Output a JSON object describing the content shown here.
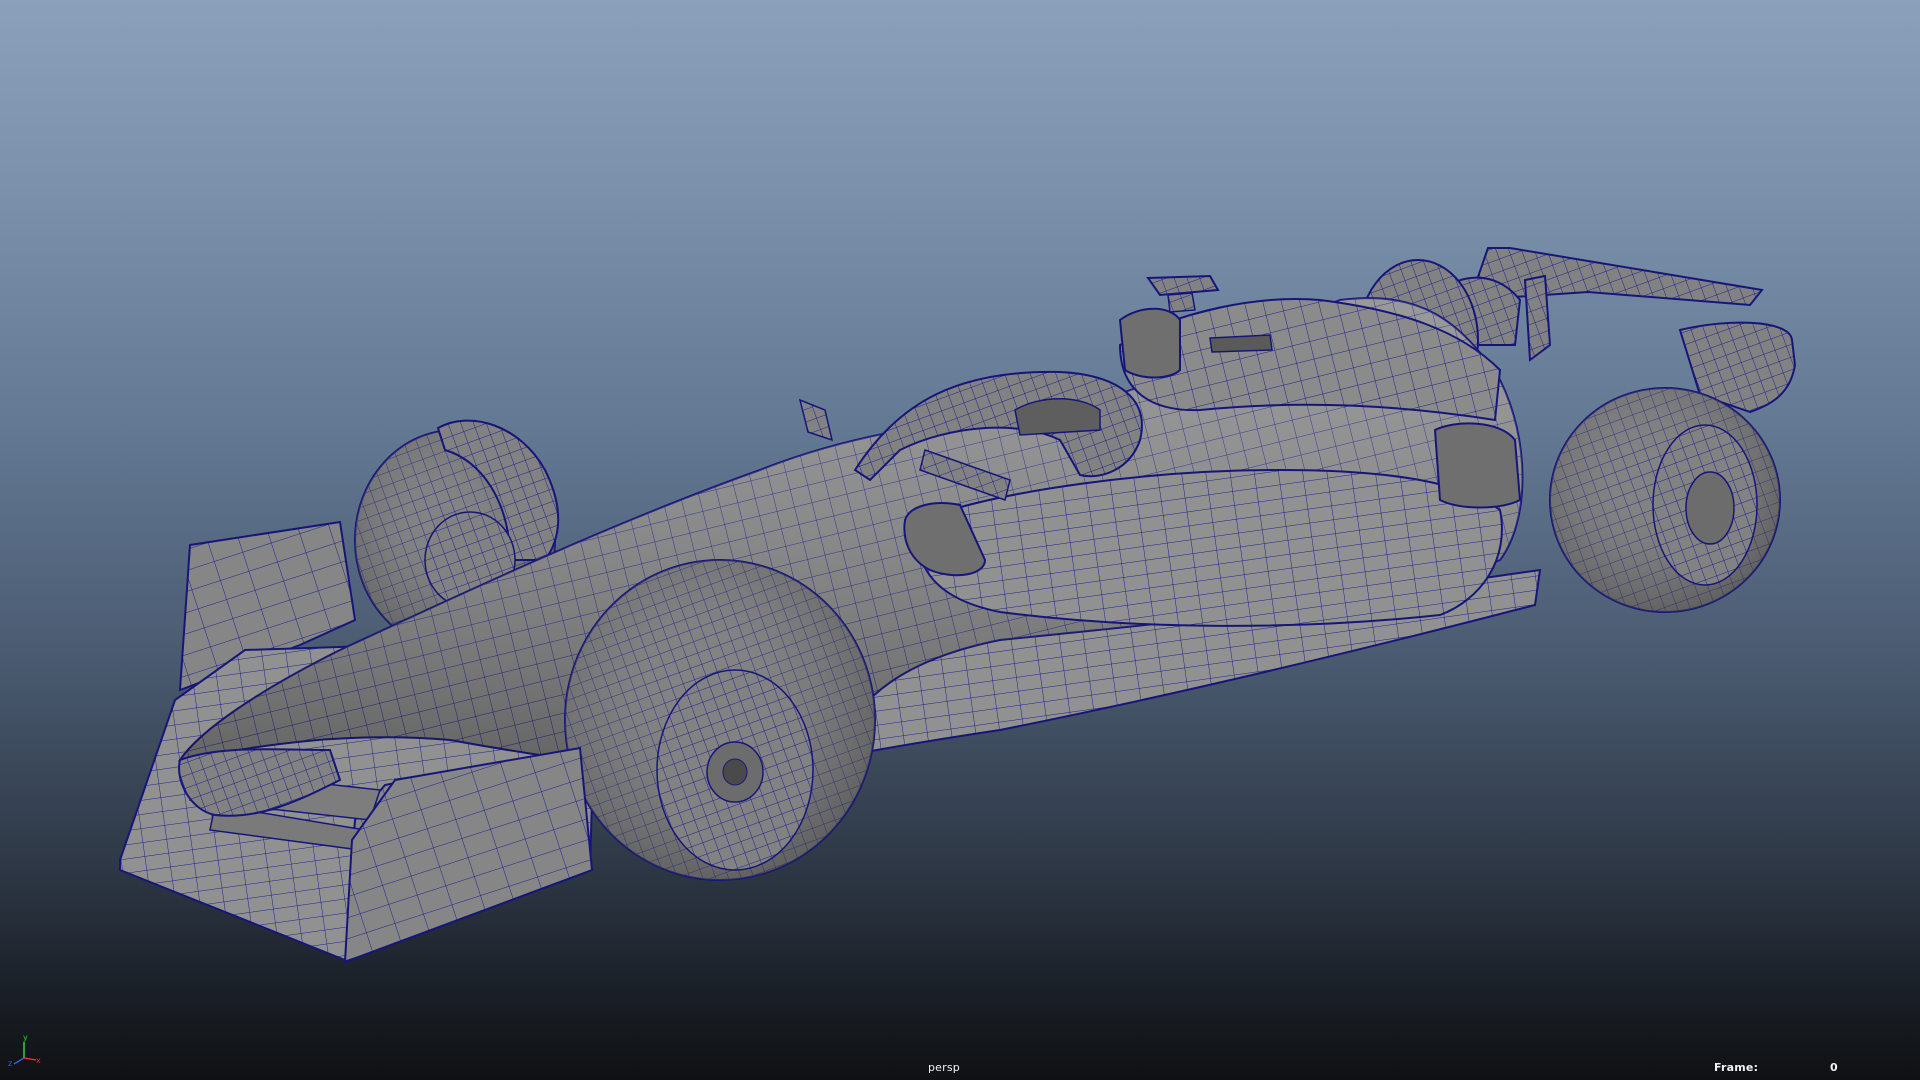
{
  "viewport": {
    "camera": "persp",
    "frame_label": "Frame:",
    "frame_value": "0",
    "wire_color": "#1a1a8c",
    "shade_color": "#8c8c8c",
    "background_top": "#8ba0bb",
    "background_bottom": "#0f1114"
  },
  "axis_gizmo": {
    "y_label": "y",
    "x_label": "x",
    "z_label": "z",
    "x_color": "#e03030",
    "y_color": "#30d040",
    "z_color": "#3060e0"
  },
  "model": {
    "object": "race-car-wireframe-on-shaded"
  }
}
